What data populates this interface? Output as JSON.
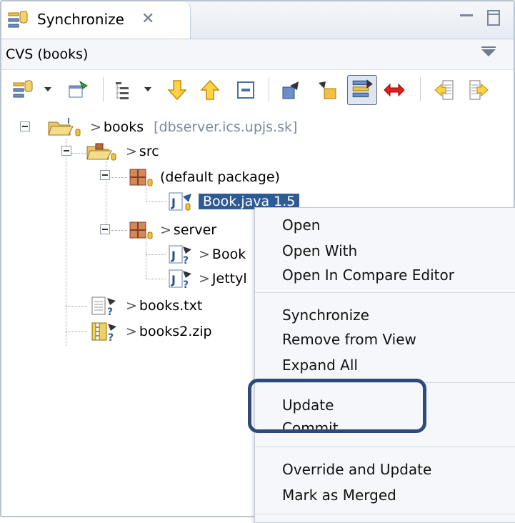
{
  "view": {
    "tab_title": "Synchronize",
    "close_glyph": "✕",
    "subtitle": "CVS (books)"
  },
  "toolbar": {
    "items": [
      "synchronize-icon",
      "dropdown",
      "pin-icon",
      "layout-icon",
      "dropdown",
      "next-difference-icon",
      "previous-difference-icon",
      "collapse-all-icon",
      "incoming-mode-icon",
      "outgoing-mode-icon",
      "incoming-outgoing-mode-icon",
      "conflicts-mode-icon",
      "update-all-icon",
      "commit-all-icon"
    ]
  },
  "tree": {
    "project": {
      "prefix": ">",
      "label": "books",
      "hint": "[dbserver.ics.upjs.sk]"
    },
    "src": {
      "prefix": ">",
      "label": "src"
    },
    "default_package": {
      "label": "(default package)"
    },
    "book_java": {
      "label": "Book.java  1.5"
    },
    "server": {
      "prefix": ">",
      "label": "server"
    },
    "book_file": {
      "prefix": ">",
      "label": "Book"
    },
    "jetty_file": {
      "prefix": ">",
      "label": "Jettyl"
    },
    "books_txt": {
      "prefix": ">",
      "label": "books.txt"
    },
    "books2_zip": {
      "prefix": ">",
      "label": "books2.zip"
    }
  },
  "context_menu": {
    "open": "Open",
    "open_with": "Open With",
    "open_compare": "Open In Compare Editor",
    "synchronize": "Synchronize",
    "remove_from_view": "Remove from View",
    "expand_all": "Expand All",
    "update": "Update",
    "commit": "Commit...",
    "override_update": "Override and Update",
    "mark_merged": "Mark as Merged"
  },
  "colors": {
    "selection": "#2f5b95",
    "highlight_border": "#2d4a7a",
    "package_icon": "#8b3a1e",
    "folder_icon": "#e7c467",
    "java_icon": "#5b7fb6"
  }
}
